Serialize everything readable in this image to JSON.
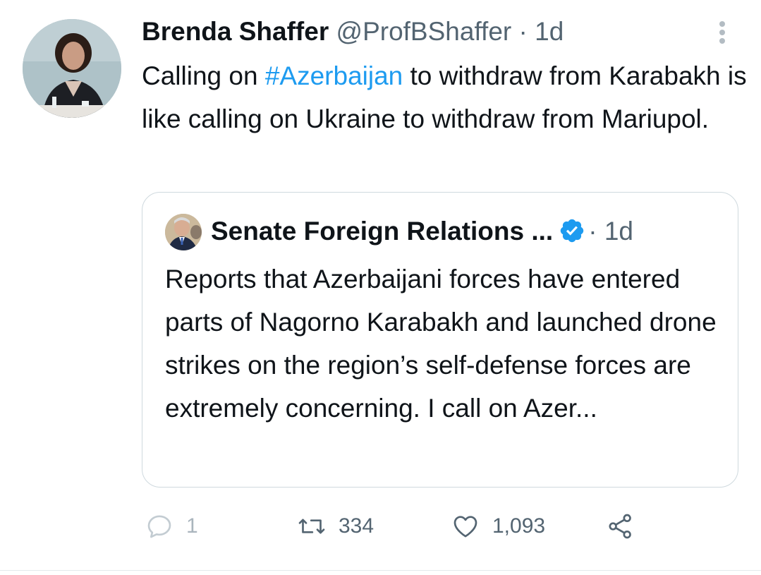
{
  "tweet": {
    "author_name": "Brenda Shaffer",
    "author_handle": "@ProfBShaffer",
    "separator": "·",
    "time": "1d",
    "text_before": "Calling on ",
    "hashtag": "#Azerbaijan",
    "text_after": " to withdraw from Karabakh is like calling on Ukraine to withdraw from Mariupol.",
    "hashtag_color": "#1d9bf0"
  },
  "quoted_tweet": {
    "author_name": "Senate Foreign Relations ...",
    "verified_icon": "verified-badge-icon",
    "separator": "·",
    "time": "1d",
    "text": "Reports that Azerbaijani forces have entered parts of Nagorno Karabakh and launched drone strikes on the region’s self-defense forces are extremely concerning. I call on Azer...",
    "verified_color": "#1d9bf0"
  },
  "actions": {
    "reply_icon": "reply-icon",
    "reply_count": "1",
    "retweet_icon": "retweet-icon",
    "retweet_count": "334",
    "like_icon": "heart-icon",
    "like_count": "1,093",
    "share_icon": "share-icon"
  },
  "menu_icon": "more-options-icon"
}
